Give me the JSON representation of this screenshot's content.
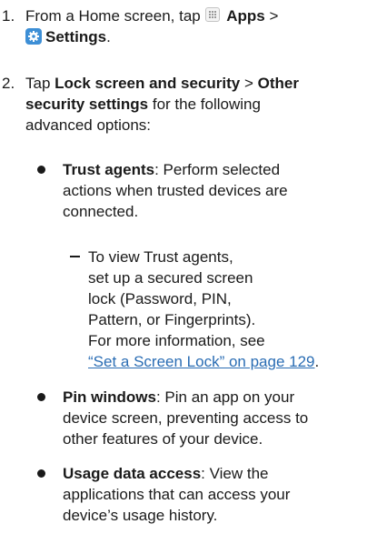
{
  "steps": [
    {
      "number": "1.",
      "line1_prefix": "From a Home screen, tap",
      "apps_label": "Apps",
      "separator": ">",
      "settings_label": "Settings",
      "line2_end": "."
    },
    {
      "number": "2.",
      "tap": "Tap",
      "lock_label": "Lock screen and security",
      "separator": ">",
      "other_line1": "Other",
      "other_line2": "security settings",
      "line2_rest": "for the following",
      "line3": "advanced options:"
    }
  ],
  "options": [
    {
      "title": "Trust agents",
      "desc_line1": ": Perform selected",
      "desc_line2": "actions when trusted devices are",
      "desc_line3": "connected."
    },
    {
      "title": "Pin windows",
      "desc_line1": ": Pin an app on your",
      "desc_line2": "device screen, preventing access to",
      "desc_line3": "other features of your device."
    },
    {
      "title": "Usage data access",
      "desc_line1": ": View the",
      "desc_line2": "applications that can access your",
      "desc_line3": "device’s usage history."
    }
  ],
  "trust_agents_note": {
    "lines": [
      "To view Trust agents,",
      "set up a secured screen",
      "lock (Password, PIN,",
      "Pattern, or Fingerprints).",
      "For more information, see"
    ],
    "link_text": "“Set a Screen Lock” on page 129",
    "link_end": "."
  },
  "icons": {
    "apps": "apps-grid-icon",
    "settings": "settings-gear-icon"
  },
  "colors": {
    "link": "#2a6db4",
    "settings_icon_bg": "#3d8fd6",
    "text": "#1a1a1a"
  }
}
